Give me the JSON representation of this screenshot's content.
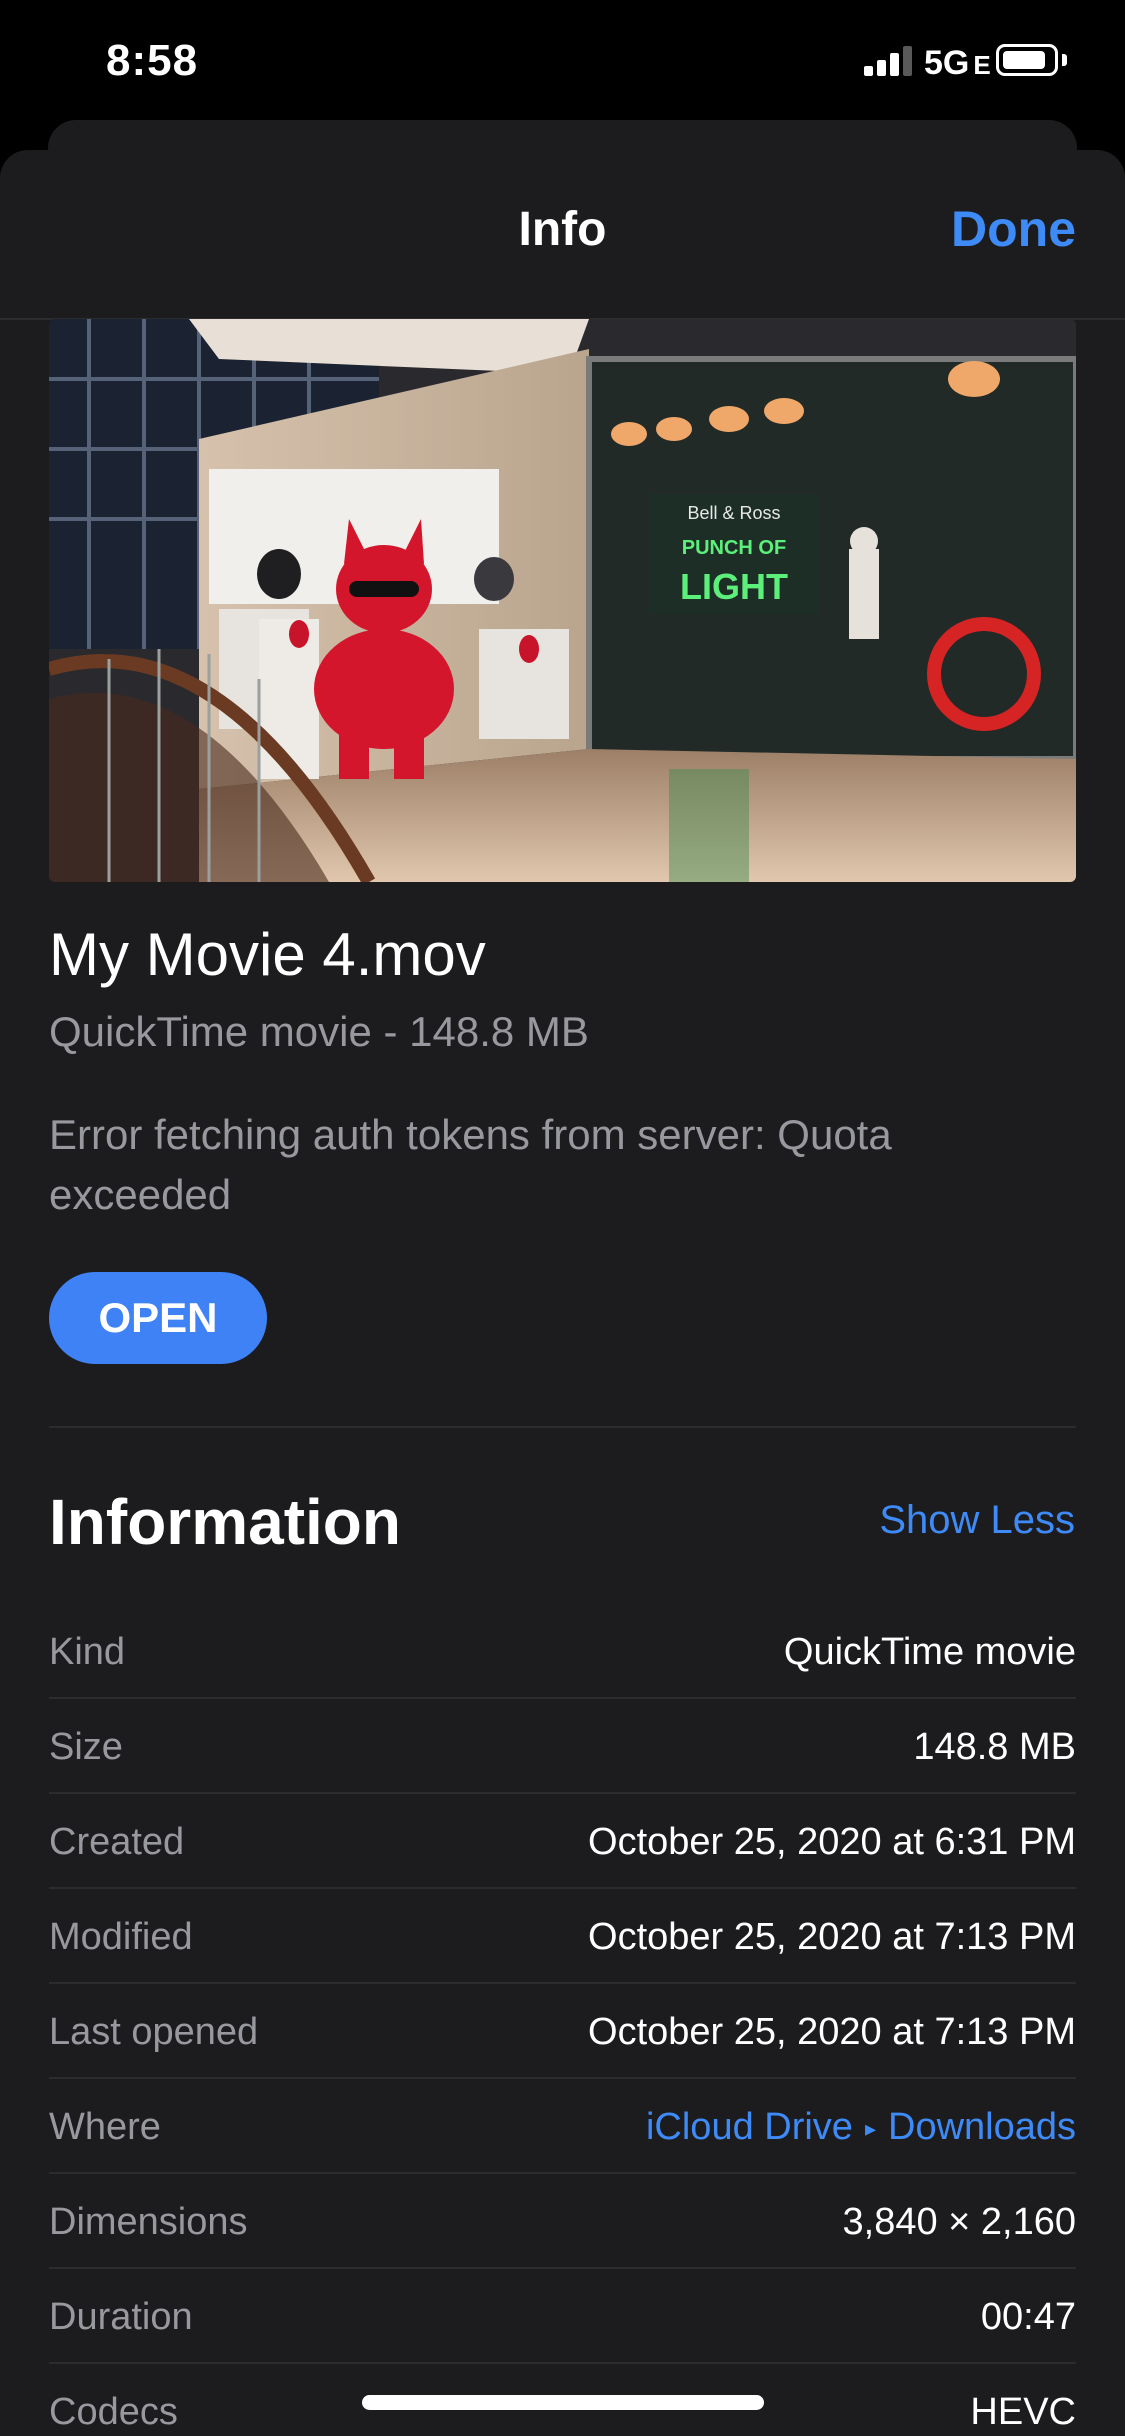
{
  "status_bar": {
    "time": "8:58",
    "network": "5G",
    "network_suffix": "E"
  },
  "nav": {
    "title": "Info",
    "done_label": "Done"
  },
  "file": {
    "name": "My Movie 4.mov",
    "meta": "QuickTime movie - 148.8 MB",
    "error": "Error fetching auth tokens from server: Quota exceeded",
    "open_label": "OPEN"
  },
  "thumbnail": {
    "sign_brand": "Bell & Ross",
    "sign_line1": "PUNCH OF",
    "sign_line2": "LIGHT"
  },
  "information": {
    "title": "Information",
    "toggle_label": "Show Less",
    "rows": [
      {
        "label": "Kind",
        "value": "QuickTime movie"
      },
      {
        "label": "Size",
        "value": "148.8 MB"
      },
      {
        "label": "Created",
        "value": "October 25, 2020 at 6:31 PM"
      },
      {
        "label": "Modified",
        "value": "October 25, 2020 at 7:13 PM"
      },
      {
        "label": "Last opened",
        "value": "October 25, 2020 at 7:13 PM"
      },
      {
        "label": "Where",
        "value_part1": "iCloud Drive",
        "value_part2": "Downloads"
      },
      {
        "label": "Dimensions",
        "value": "3,840 × 2,160"
      },
      {
        "label": "Duration",
        "value": "00:47"
      },
      {
        "label": "Codecs",
        "value": "HEVC"
      }
    ]
  },
  "colors": {
    "accent": "#3e8bf7",
    "button": "#3e82f6",
    "sheet": "#1c1c1e",
    "secondary_text": "#98989f"
  }
}
